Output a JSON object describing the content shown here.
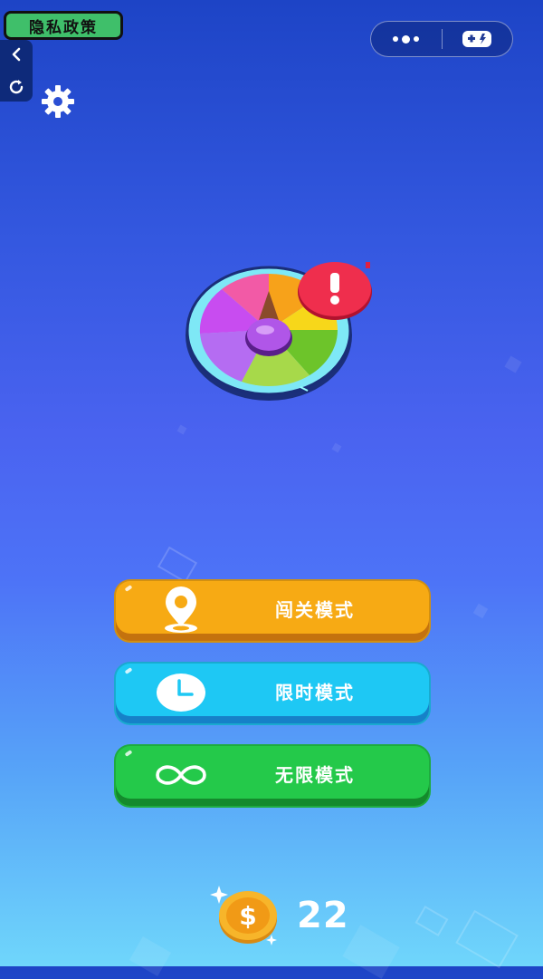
{
  "header": {
    "privacy_label": "隐私政策",
    "back_icon": "chevron-left-icon",
    "refresh_icon": "refresh-icon",
    "settings_icon": "gear-icon",
    "capsule_menu_icon": "more-dots-icon",
    "capsule_game_icon": "gamepad-icon"
  },
  "hero": {
    "icon": "spin-wheel-icon",
    "alert_icon": "exclamation-badge-icon"
  },
  "modes": [
    {
      "label": "闯关模式",
      "icon": "location-pin-icon",
      "color": "#f7aa14"
    },
    {
      "label": "限时模式",
      "icon": "clock-icon",
      "color": "#1ec8f4"
    },
    {
      "label": "无限模式",
      "icon": "infinity-icon",
      "color": "#24c94a"
    }
  ],
  "coins": {
    "icon": "dollar-coin-icon",
    "count": "22"
  }
}
